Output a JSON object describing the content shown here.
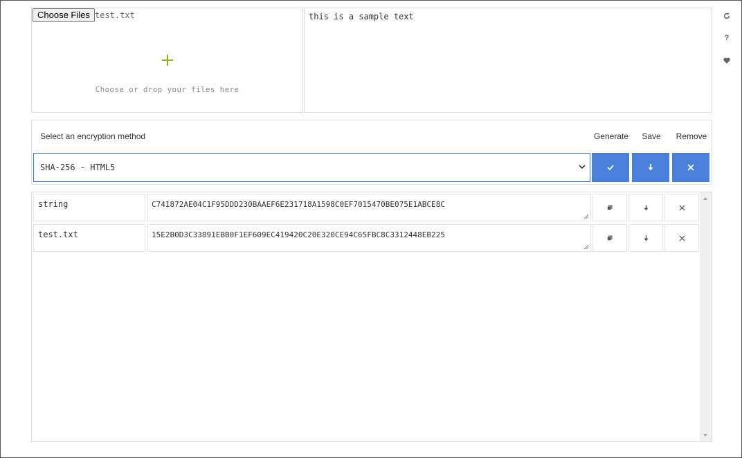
{
  "input": {
    "choose_files_label": "Choose Files",
    "file_name": "test.txt",
    "drop_hint": "Choose or drop your files here",
    "text_value": "this is a sample text"
  },
  "side_icons": [
    {
      "name": "refresh-icon",
      "glyph": "↻"
    },
    {
      "name": "help-icon",
      "glyph": "?"
    },
    {
      "name": "heart-icon",
      "glyph": "♥"
    }
  ],
  "method": {
    "label": "Select an encryption method",
    "selected": "SHA-256 - HTML5",
    "generate_label": "Generate",
    "save_label": "Save",
    "remove_label": "Remove",
    "accent_color": "#4a7fdc"
  },
  "results": [
    {
      "name": "string",
      "hash": "C741872AE04C1F95DDD230BAAEF6E231718A1598C0EF7015470BE075E1ABCE8C"
    },
    {
      "name": "test.txt",
      "hash": "15E2B0D3C33891EBB0F1EF609EC419420C20E320CE94C65FBC8C3312448EB225"
    }
  ]
}
